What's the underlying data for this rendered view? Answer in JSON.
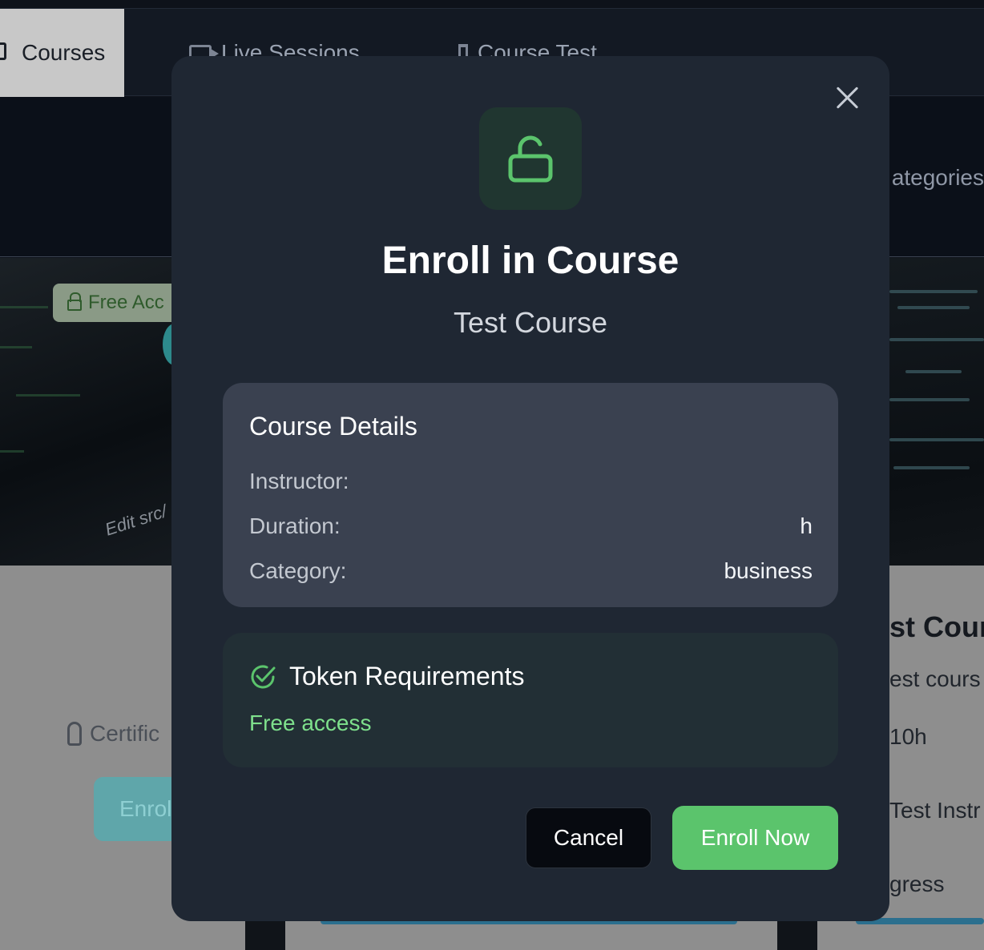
{
  "background": {
    "tabs": [
      {
        "label": "Courses",
        "icon": "book-icon"
      },
      {
        "label": "Live Sessions",
        "icon": "video-icon"
      },
      {
        "label": "Course Test",
        "icon": "flask-icon"
      }
    ],
    "hero_categories_text": "ategories",
    "badge_text": "Free Acc",
    "image_caption": "Edit src/",
    "certificate_text": "Certific",
    "enroll_ghost_text": "Enrol",
    "right_card": {
      "title": "st Cour",
      "description": "est cours",
      "duration": "10h",
      "instructor": "Test Instr",
      "progress": "gress"
    }
  },
  "modal": {
    "icon": "unlock-icon",
    "title": "Enroll in Course",
    "course_name": "Test Course",
    "details": {
      "heading": "Course Details",
      "rows": [
        {
          "label": "Instructor:",
          "value": ""
        },
        {
          "label": "Duration:",
          "value": "h"
        },
        {
          "label": "Category:",
          "value": "business"
        }
      ]
    },
    "token": {
      "heading": "Token Requirements",
      "value": "Free access",
      "icon": "check-circle-icon"
    },
    "buttons": {
      "cancel": "Cancel",
      "enroll": "Enroll Now"
    },
    "colors": {
      "accent_green": "#5bc46c",
      "modal_bg": "#1f2733"
    }
  }
}
